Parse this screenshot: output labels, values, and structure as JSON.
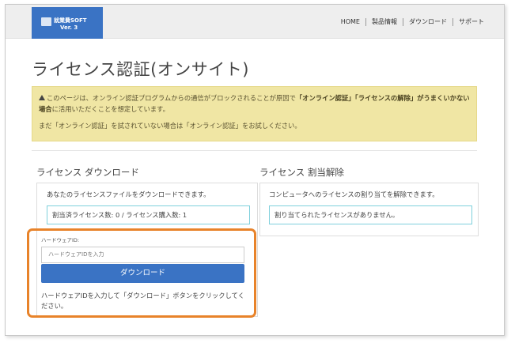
{
  "header": {
    "logo_line1": "就業費SOFT",
    "logo_line2": "Ver. 3",
    "nav": [
      "HOME",
      "製品情報",
      "ダウンロード",
      "サポート"
    ]
  },
  "page": {
    "title": "ライセンス認証(オンサイト)"
  },
  "alert": {
    "text_before": "このページは、オンライン認証プログラムからの通信がブロックされることが原因で",
    "bold_text": "「オンライン認証」「ライセンスの解除」がうまくいかない場合",
    "text_after": "に活用いただくことを想定しています。",
    "second": "まだ「オンライン認証」を試されていない場合は「オンライン認証」をお試しください。"
  },
  "download": {
    "title": "ライセンス ダウンロード",
    "desc": "あなたのライセンスファイルをダウンロードできます。",
    "count": "割当済ライセンス数: 0 / ライセンス購入数: 1",
    "hw_label": "ハードウェアID:",
    "hw_placeholder": "ハードウェアIDを入力",
    "button": "ダウンロード",
    "help": "ハードウェアIDを入力して「ダウンロード」ボタンをクリックしてください。"
  },
  "unassign": {
    "title": "ライセンス 割当解除",
    "desc": "コンピュータへのライセンスの割り当てを解除できます。",
    "status": "割り当てられたライセンスがありません。"
  },
  "colors": {
    "primary": "#3a73c4",
    "alert_bg": "#f0e6a4",
    "highlight": "#e8832a",
    "info_border": "#7fd0dc"
  }
}
